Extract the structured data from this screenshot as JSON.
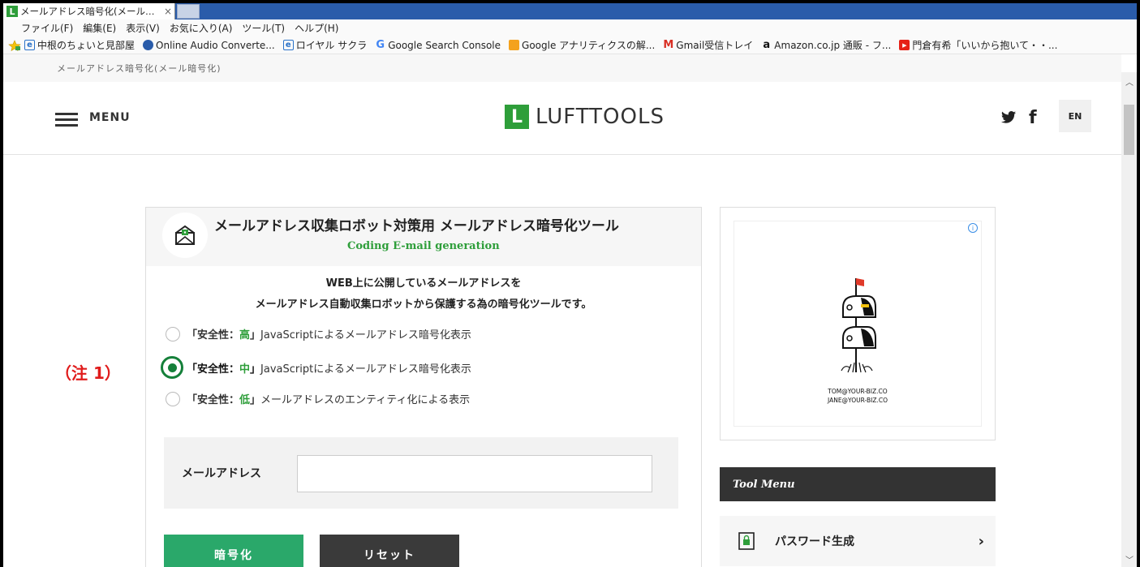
{
  "browser": {
    "tab_title": "メールアドレス暗号化(メール…",
    "tab_close": "×",
    "favicon": "L",
    "menus": [
      "ファイル(F)",
      "編集(E)",
      "表示(V)",
      "お気に入り(A)",
      "ツール(T)",
      "ヘルプ(H)"
    ],
    "favorites": [
      {
        "label": "中根のちょいと見部屋",
        "icon": "ie-icon"
      },
      {
        "label": "Online Audio Converte...",
        "icon": "audio-converter-icon"
      },
      {
        "label": "ロイヤル サクラ",
        "icon": "ie-icon"
      },
      {
        "label": "Google Search Console",
        "icon": "google-icon"
      },
      {
        "label": "Google アナリティクスの解...",
        "icon": "analytics-icon"
      },
      {
        "label": "Gmail受信トレイ",
        "icon": "gmail-icon"
      },
      {
        "label": "Amazon.co.jp 通販 - フ...",
        "icon": "amazon-icon"
      },
      {
        "label": "門倉有希「いいから抱いて・・...",
        "icon": "youtube-icon"
      }
    ]
  },
  "page": {
    "breadcrumb": "メールアドレス暗号化(メール暗号化)",
    "header": {
      "menu_label": "MENU",
      "logo_mark": "L",
      "logo_text": "LUFTTOOLS",
      "twitter_glyph": "🐦",
      "facebook_glyph": "f",
      "lang_label": "EN"
    },
    "tool": {
      "title": "メールアドレス収集ロボット対策用 メールアドレス暗号化ツール",
      "subtitle": "Coding E-mail generation",
      "description_line1": "WEB上に公開しているメールアドレスを",
      "description_line2": "メールアドレス自動収集ロボットから保護する為の暗号化ツールです。",
      "options": [
        {
          "pre": "「安全性：",
          "level": "高",
          "post": "」",
          "text": "JavaScriptによるメールアドレス暗号化表示",
          "selected": false
        },
        {
          "pre": "「安全性：",
          "level": "中",
          "post": "」",
          "text": "JavaScriptによるメールアドレス暗号化表示",
          "selected": true
        },
        {
          "pre": "「安全性：",
          "level": "低",
          "post": "」",
          "text": "メールアドレスのエンティティ化による表示",
          "selected": false
        }
      ],
      "email_label": "メールアドレス",
      "email_value": "",
      "encrypt_button": "暗号化",
      "reset_button": "リセット"
    },
    "annotation": "（注 1）",
    "ad": {
      "adchoices": "i",
      "email1": "TOM@YOUR-BIZ.CO",
      "email2": "JANE@YOUR-BIZ.CO"
    },
    "tool_menu": {
      "heading": "Tool Menu",
      "items": [
        {
          "label": "パスワード生成",
          "icon": "password-lock-icon",
          "arrow": "›"
        }
      ]
    }
  },
  "colors": {
    "brand_green": "#2e9e3a",
    "button_green": "#2aa86a",
    "annotation_red": "#e01b1b",
    "tab_bar_blue": "#2a5caa"
  }
}
